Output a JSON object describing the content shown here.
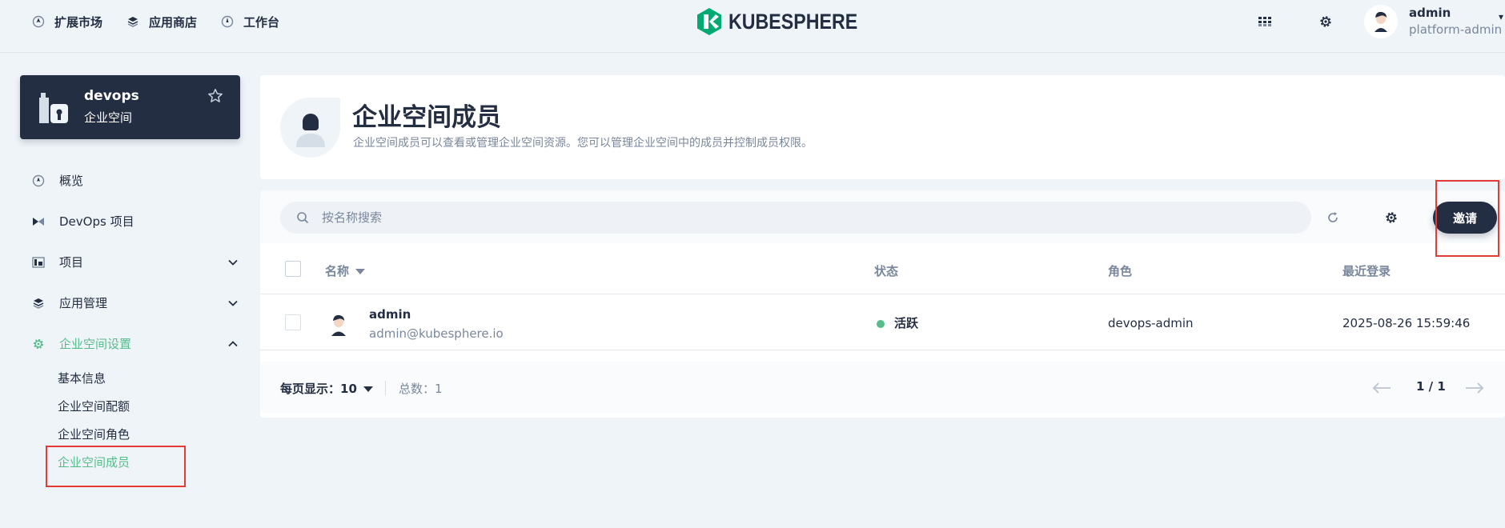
{
  "topnav": {
    "items": [
      {
        "label": "扩展市场",
        "icon": "extension-icon"
      },
      {
        "label": "应用商店",
        "icon": "app-store-icon"
      },
      {
        "label": "工作台",
        "icon": "workbench-icon"
      }
    ],
    "logo_text": "KUBESPHERE",
    "user": {
      "name": "admin",
      "role": "platform-admin"
    }
  },
  "workspace": {
    "name": "devops",
    "type": "企业空间"
  },
  "sidebar": {
    "items": [
      {
        "label": "概览",
        "icon": "overview-icon"
      },
      {
        "label": "DevOps 项目",
        "icon": "devops-icon"
      },
      {
        "label": "项目",
        "icon": "project-icon"
      },
      {
        "label": "应用管理",
        "icon": "app-management-icon"
      },
      {
        "label": "企业空间设置",
        "icon": "settings-icon"
      }
    ],
    "sub_items": [
      "基本信息",
      "企业空间配额",
      "企业空间角色",
      "企业空间成员"
    ],
    "active_sub": "企业空间成员"
  },
  "header": {
    "title": "企业空间成员",
    "description": "企业空间成员可以查看或管理企业空间资源。您可以管理企业空间中的成员并控制成员权限。"
  },
  "toolbar": {
    "search_placeholder": "按名称搜索",
    "invite_label": "邀请"
  },
  "table": {
    "columns": [
      "名称",
      "状态",
      "角色",
      "最近登录"
    ],
    "rows": [
      {
        "name": "admin",
        "email": "admin@kubesphere.io",
        "status": "活跃",
        "role": "devops-admin",
        "last_login": "2025-08-26 15:59:46"
      }
    ]
  },
  "pagination": {
    "page_size_label": "每页显示：",
    "page_size": "10",
    "total": "总数：1",
    "page": "1 / 1"
  },
  "colors": {
    "brand_green": "#00aa72",
    "active_green": "#55bc8a",
    "dark": "#242e42",
    "highlight_red": "#e53935"
  }
}
